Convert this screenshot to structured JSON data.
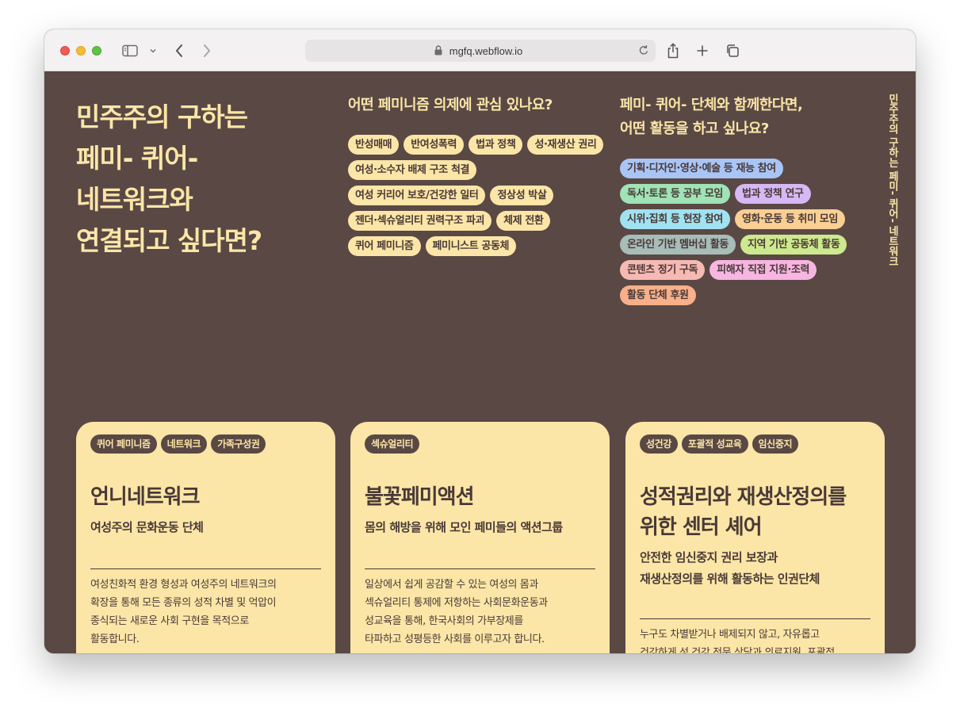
{
  "browser": {
    "url": "mgfq.webflow.io"
  },
  "hero": {
    "title_lines": [
      "민주주의 구하는",
      "페미- 퀴어-",
      "네트워크와",
      "연결되고 싶다면?"
    ]
  },
  "agenda": {
    "title": "어떤 페미니즘 의제에 관심 있나요?",
    "tags": [
      "반성매매",
      "반여성폭력",
      "법과 정책",
      "성·재생산 권리",
      "여성·소수자 배제 구조 척결",
      "여성 커리어 보호/건강한 일터",
      "정상성 박살",
      "젠더·섹슈얼리티 권력구조 파괴",
      "체제 전환",
      "퀴어 페미니즘",
      "페미니스트 공동체"
    ]
  },
  "activity": {
    "title_lines": [
      "페미- 퀴어- 단체와 함께한다면,",
      "어떤 활동을 하고 싶나요?"
    ],
    "tags": [
      {
        "label": "기획·디자인·영상·예술 등 재능 참여",
        "color": "#a9c5f6"
      },
      {
        "label": "독서·토론 등 공부 모임",
        "color": "#9fe3b6"
      },
      {
        "label": "법과 정책 연구",
        "color": "#d6b8f4"
      },
      {
        "label": "시위·집회 등 현장 참여",
        "color": "#9fe2f0"
      },
      {
        "label": "영화·운동 등 취미 모임",
        "color": "#f9cf94"
      },
      {
        "label": "온라인 기반 멤버십 활동",
        "color": "#a8bcb8"
      },
      {
        "label": "지역 기반 공동체 활동",
        "color": "#cde98e"
      },
      {
        "label": "콘텐츠 정기 구독",
        "color": "#f7b9b3"
      },
      {
        "label": "피해자 직접 지원·조력",
        "color": "#f7b6e2"
      },
      {
        "label": "활동 단체 후원",
        "color": "#f7b089"
      }
    ]
  },
  "side_text": "민주주의 구하는 페미- 퀴어- 네트워크",
  "cards": [
    {
      "tags": [
        "퀴어 페미니즘",
        "네트워크",
        "가족구성권"
      ],
      "name_lines": [
        "언니네트워크"
      ],
      "sub_lines": [
        "여성주의 문화운동 단체"
      ],
      "desc_lines": [
        "여성친화적 환경 형성과 여성주의 네트워크의",
        "확장을 통해 모든 종류의 성적 차별 및 억압이",
        "종식되는 새로운 사회 구현을 목적으로",
        "활동합니다."
      ]
    },
    {
      "tags": [
        "섹슈얼리티"
      ],
      "name_lines": [
        "불꽃페미액션"
      ],
      "sub_lines": [
        "몸의 해방을 위해 모인 페미들의 액션그룹"
      ],
      "desc_lines": [
        "일상에서 쉽게 공감할 수 있는 여성의 몸과",
        "섹슈얼리티 통제에 저항하는 사회문화운동과",
        "성교육을 통해, 한국사회의 가부장제를",
        "타파하고 성평등한 사회를 이루고자 합니다."
      ]
    },
    {
      "tags": [
        "성건강",
        "포괄적 성교육",
        "임신중지"
      ],
      "name_lines": [
        "성적권리와 재생산정의를",
        "위한 센터 셰어"
      ],
      "sub_lines": [
        "안전한 임신중지 권리 보장과",
        "재생산정의를 위해 활동하는 인권단체"
      ],
      "desc_lines": [
        "누구도 차별받거나 배제되지 않고, 자유롭고",
        "건강하게 성 건강 전문 상담과 의료지원, 포괄적"
      ]
    }
  ]
}
